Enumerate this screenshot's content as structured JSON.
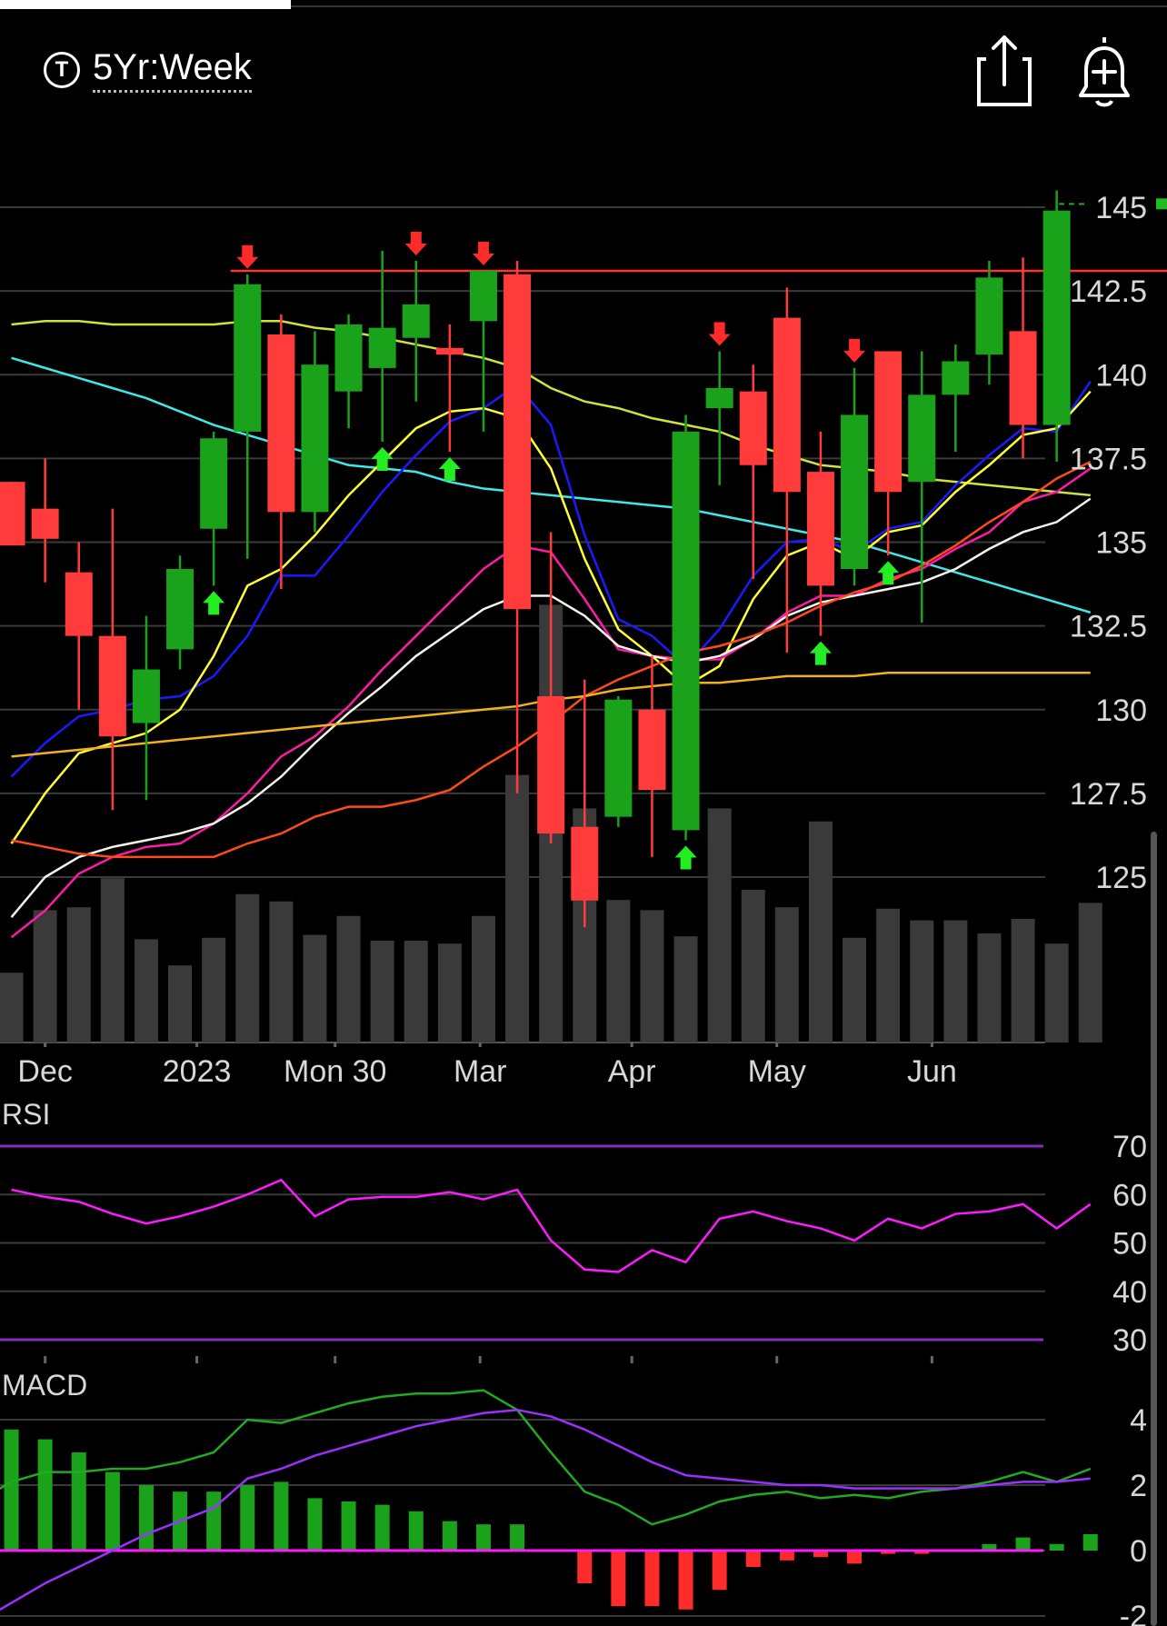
{
  "header": {
    "timeframe_icon": "T",
    "timeframe_label": "5Yr:Week",
    "share_icon": "share-icon",
    "alert_icon": "bell-plus-icon"
  },
  "chart_data": [
    {
      "type": "candlestick",
      "title": "",
      "price_ticks": [
        "145",
        "142.5",
        "140",
        "137.5",
        "135",
        "132.5",
        "130",
        "127.5",
        "125"
      ],
      "price_tick_values": [
        145,
        142.5,
        140,
        137.5,
        135,
        132.5,
        130,
        127.5,
        125
      ],
      "ylim": [
        124,
        147.5
      ],
      "x_ticks": [
        {
          "label": "Dec",
          "index": 1
        },
        {
          "label": "2023",
          "index": 5.5
        },
        {
          "label": "Mon 30",
          "index": 9.6
        },
        {
          "label": "Mar",
          "index": 13.9
        },
        {
          "label": "Apr",
          "index": 18.4
        },
        {
          "label": "May",
          "index": 22.7
        },
        {
          "label": "Jun",
          "index": 27.3
        }
      ],
      "candles": [
        {
          "o": 136.8,
          "h": 136.8,
          "l": 134.9,
          "c": 134.9
        },
        {
          "o": 136.0,
          "h": 137.5,
          "l": 133.8,
          "c": 135.1
        },
        {
          "o": 134.1,
          "h": 135.0,
          "l": 130.0,
          "c": 132.2
        },
        {
          "o": 132.2,
          "h": 136.0,
          "l": 127.0,
          "c": 129.2
        },
        {
          "o": 129.6,
          "h": 132.8,
          "l": 127.3,
          "c": 131.2
        },
        {
          "o": 131.8,
          "h": 134.6,
          "l": 131.2,
          "c": 134.2
        },
        {
          "o": 135.4,
          "h": 138.3,
          "l": 133.7,
          "c": 138.1
        },
        {
          "o": 138.3,
          "h": 143.0,
          "l": 134.5,
          "c": 142.7
        },
        {
          "o": 141.2,
          "h": 141.8,
          "l": 133.6,
          "c": 135.9
        },
        {
          "o": 135.9,
          "h": 141.3,
          "l": 135.3,
          "c": 140.3
        },
        {
          "o": 139.5,
          "h": 141.8,
          "l": 138.4,
          "c": 141.5
        },
        {
          "o": 140.2,
          "h": 143.7,
          "l": 138.0,
          "c": 141.4
        },
        {
          "o": 141.1,
          "h": 143.4,
          "l": 139.2,
          "c": 142.1
        },
        {
          "o": 140.8,
          "h": 141.5,
          "l": 137.7,
          "c": 140.6
        },
        {
          "o": 141.6,
          "h": 143.1,
          "l": 138.3,
          "c": 143.1
        },
        {
          "o": 143.0,
          "h": 143.4,
          "l": 127.5,
          "c": 133.0
        },
        {
          "o": 130.4,
          "h": 135.3,
          "l": 126.0,
          "c": 126.3
        },
        {
          "o": 126.5,
          "h": 130.9,
          "l": 123.5,
          "c": 124.3
        },
        {
          "o": 126.8,
          "h": 130.4,
          "l": 126.5,
          "c": 130.3
        },
        {
          "o": 130.0,
          "h": 131.6,
          "l": 125.6,
          "c": 127.6
        },
        {
          "o": 126.4,
          "h": 138.8,
          "l": 126.1,
          "c": 138.3
        },
        {
          "o": 139.0,
          "h": 140.7,
          "l": 136.7,
          "c": 139.6
        },
        {
          "o": 139.5,
          "h": 140.3,
          "l": 133.9,
          "c": 137.3
        },
        {
          "o": 141.7,
          "h": 142.6,
          "l": 131.7,
          "c": 136.5
        },
        {
          "o": 137.1,
          "h": 138.3,
          "l": 132.2,
          "c": 133.7
        },
        {
          "o": 134.2,
          "h": 140.2,
          "l": 133.7,
          "c": 138.8
        },
        {
          "o": 140.7,
          "h": 140.7,
          "l": 134.6,
          "c": 136.5
        },
        {
          "o": 136.8,
          "h": 140.7,
          "l": 132.6,
          "c": 139.4
        },
        {
          "o": 139.4,
          "h": 140.9,
          "l": 137.7,
          "c": 140.4
        },
        {
          "o": 140.6,
          "h": 143.4,
          "l": 139.7,
          "c": 142.9
        },
        {
          "o": 141.3,
          "h": 143.5,
          "l": 137.5,
          "c": 138.5
        },
        {
          "o": 138.5,
          "h": 145.5,
          "l": 137.4,
          "c": 144.9
        }
      ],
      "volume": [
        0.48,
        0.91,
        0.93,
        1.13,
        0.71,
        0.53,
        0.72,
        1.02,
        0.97,
        0.74,
        0.87,
        0.7,
        0.7,
        0.68,
        0.87,
        1.84,
        3.01,
        1.61,
        0.98,
        0.91,
        0.73,
        1.61,
        1.05,
        0.93,
        1.52,
        0.72,
        0.92,
        0.84,
        0.84,
        0.75,
        0.85,
        0.68,
        0.96
      ],
      "overlays": [
        {
          "name": "",
          "color": "#cfe33a",
          "values": [
            141.5,
            141.6,
            141.6,
            141.5,
            141.5,
            141.5,
            141.5,
            141.6,
            141.6,
            141.4,
            141.3,
            141.1,
            140.9,
            140.7,
            140.5,
            140.2,
            139.6,
            139.2,
            139.0,
            138.7,
            138.5,
            138.3,
            137.9,
            137.6,
            137.3,
            137.2,
            137.1,
            136.9,
            136.8,
            136.7,
            136.6,
            136.5,
            136.4
          ]
        },
        {
          "name": "",
          "color": "#3ee8e8",
          "values": [
            140.5,
            140.2,
            139.9,
            139.6,
            139.3,
            138.9,
            138.5,
            138.2,
            137.9,
            137.6,
            137.3,
            137.2,
            137.1,
            136.8,
            136.6,
            136.5,
            136.4,
            136.3,
            136.2,
            136.1,
            136.0,
            135.8,
            135.6,
            135.4,
            135.2,
            135.0,
            134.7,
            134.4,
            134.1,
            133.8,
            133.5,
            133.2,
            132.9
          ]
        },
        {
          "name": "",
          "color": "#1a1aff",
          "values": [
            128.0,
            129.0,
            129.8,
            130.0,
            130.3,
            130.4,
            131.0,
            132.2,
            134.0,
            134.0,
            135.2,
            136.5,
            137.6,
            138.6,
            139.0,
            139.7,
            138.5,
            135.2,
            132.7,
            132.2,
            131.3,
            132.4,
            134.0,
            135.0,
            135.1,
            134.7,
            135.4,
            135.6,
            136.7,
            137.6,
            138.4,
            138.3,
            139.8
          ]
        },
        {
          "name": "",
          "color": "#ffff33",
          "values": [
            126.0,
            127.5,
            128.7,
            129.0,
            129.3,
            130.0,
            131.6,
            133.7,
            134.2,
            135.2,
            136.4,
            137.4,
            138.4,
            138.9,
            139.0,
            138.7,
            137.2,
            134.5,
            132.4,
            131.6,
            130.7,
            131.3,
            133.3,
            134.6,
            135.0,
            134.5,
            135.3,
            135.5,
            136.5,
            137.3,
            138.2,
            138.4,
            139.5
          ]
        },
        {
          "name": "",
          "color": "#ff1aa8",
          "values": [
            123.2,
            124.0,
            125.1,
            125.6,
            125.9,
            126.0,
            126.6,
            127.5,
            128.6,
            129.2,
            130.1,
            131.2,
            132.2,
            133.2,
            134.2,
            134.9,
            134.7,
            133.3,
            131.8,
            131.6,
            131.5,
            131.5,
            132.1,
            132.9,
            133.4,
            133.4,
            133.9,
            134.2,
            134.8,
            135.3,
            136.2,
            136.5,
            137.2
          ]
        },
        {
          "name": "",
          "color": "#f4f4e8",
          "values": [
            123.8,
            125.0,
            125.6,
            125.9,
            126.1,
            126.3,
            126.6,
            127.2,
            128.0,
            129.0,
            129.9,
            130.7,
            131.6,
            132.3,
            133.0,
            133.4,
            133.4,
            132.8,
            131.9,
            131.6,
            131.4,
            131.6,
            132.1,
            132.8,
            133.2,
            133.4,
            133.6,
            133.8,
            134.2,
            134.8,
            135.3,
            135.6,
            136.3
          ]
        },
        {
          "name": "",
          "color": "#ff4a1a",
          "values": [
            126.1,
            125.9,
            125.7,
            125.6,
            125.6,
            125.6,
            125.6,
            126.0,
            126.3,
            126.8,
            127.1,
            127.1,
            127.3,
            127.6,
            128.3,
            128.9,
            129.6,
            130.4,
            130.9,
            131.3,
            131.7,
            131.9,
            132.2,
            132.6,
            133.1,
            133.5,
            133.8,
            134.3,
            134.9,
            135.6,
            136.2,
            136.9,
            137.4
          ]
        },
        {
          "name": "",
          "color": "#f2b31a",
          "values": [
            128.6,
            128.7,
            128.8,
            128.9,
            129.0,
            129.1,
            129.2,
            129.3,
            129.4,
            129.5,
            129.6,
            129.7,
            129.8,
            129.9,
            130.0,
            130.1,
            130.3,
            130.4,
            130.6,
            130.7,
            130.8,
            130.8,
            130.9,
            131.0,
            131.0,
            131.0,
            131.1,
            131.1,
            131.1,
            131.1,
            131.1,
            131.1,
            131.1
          ]
        }
      ],
      "resistance_line": {
        "from_index": 6.5,
        "value": 143.1,
        "color": "#ff3333"
      },
      "last_price": 145.1,
      "signals_up": [
        6,
        11,
        13,
        20,
        24,
        26
      ],
      "signals_down": [
        7,
        12,
        14,
        21,
        25
      ],
      "grid": true
    },
    {
      "type": "line",
      "title": "RSI",
      "ylim": [
        25,
        75
      ],
      "y_ticks": [
        70,
        60,
        50,
        40,
        30
      ],
      "bands": [
        70,
        30
      ],
      "series": [
        {
          "name": "",
          "color": "#ff1aff",
          "values": [
            61,
            59.5,
            58.5,
            56,
            54,
            55.5,
            57.5,
            60,
            63,
            55.5,
            59,
            59.5,
            59.5,
            60.5,
            59,
            61,
            50.5,
            44.5,
            44,
            48.5,
            46,
            55,
            56.5,
            54.5,
            53,
            50.5,
            55,
            53,
            56,
            56.5,
            58,
            53,
            58
          ]
        }
      ]
    },
    {
      "type": "bar+line",
      "title": "MACD",
      "ylim": [
        -3,
        5.2
      ],
      "y_ticks": [
        4,
        2,
        0,
        -2
      ],
      "histogram": [
        3.7,
        3.4,
        3.0,
        2.4,
        2.0,
        1.8,
        1.8,
        2.0,
        2.1,
        1.6,
        1.5,
        1.4,
        1.2,
        0.9,
        0.8,
        0.8,
        0.0,
        -1.0,
        -1.7,
        -1.7,
        -1.8,
        -1.2,
        -0.5,
        -0.3,
        -0.2,
        -0.4,
        -0.1,
        -0.1,
        0.0,
        0.2,
        0.4,
        0.2,
        0.5
      ],
      "series": [
        {
          "name": "",
          "color": "#22aa22",
          "values": [
            1.5,
            2.1,
            2.4,
            2.4,
            2.5,
            2.5,
            2.7,
            3.0,
            4.0,
            3.9,
            4.2,
            4.5,
            4.7,
            4.8,
            4.8,
            4.9,
            4.3,
            3.0,
            1.8,
            1.4,
            0.8,
            1.1,
            1.5,
            1.7,
            1.8,
            1.6,
            1.7,
            1.6,
            1.8,
            1.9,
            2.1,
            2.4,
            2.1,
            2.5
          ]
        },
        {
          "name": "",
          "color": "#9b30ff",
          "values": [
            -2.2,
            -1.6,
            -1.0,
            -0.5,
            0.0,
            0.5,
            0.9,
            1.3,
            2.2,
            2.5,
            2.9,
            3.2,
            3.5,
            3.8,
            4.0,
            4.2,
            4.3,
            4.1,
            3.7,
            3.2,
            2.7,
            2.3,
            2.2,
            2.1,
            2.0,
            2.0,
            1.9,
            1.9,
            1.9,
            1.9,
            2.0,
            2.1,
            2.1,
            2.2
          ]
        }
      ]
    }
  ]
}
